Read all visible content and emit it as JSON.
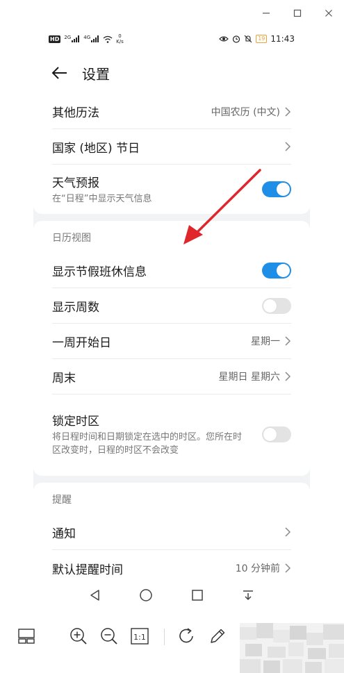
{
  "statusbar": {
    "hd": "HD",
    "sig1_label": "2G",
    "sig2_label": "4G",
    "speed_value": "0",
    "speed_unit": "K/s",
    "battery": "19",
    "time": "11:43"
  },
  "header": {
    "title": "设置"
  },
  "group1": {
    "rows": [
      {
        "label": "其他历法",
        "value": "中国农历 (中文)"
      },
      {
        "label": "国家 (地区) 节日",
        "value": ""
      },
      {
        "label": "天气预报",
        "sub": "在“日程”中显示天气信息",
        "toggle": "on"
      }
    ]
  },
  "group2": {
    "title": "日历视图",
    "rows": [
      {
        "label": "显示节假班休信息",
        "toggle": "on"
      },
      {
        "label": "显示周数",
        "toggle": "off"
      },
      {
        "label": "一周开始日",
        "value": "星期一"
      },
      {
        "label": "周末",
        "value": "星期日 星期六"
      },
      {
        "label": "锁定时区",
        "sub": "将日程时间和日期锁定在选中的时区。您所在时区改变时，日程的时区不会改变",
        "toggle": "off"
      }
    ]
  },
  "group3": {
    "title": "提醒",
    "rows": [
      {
        "label": "通知",
        "value": ""
      },
      {
        "label": "默认提醒时间",
        "value": "10 分钟前"
      }
    ]
  },
  "colors": {
    "accent": "#1f8ee6",
    "annotation_arrow": "#e0262a",
    "toggle_off": "#e3e3e3"
  },
  "icons": {
    "window": [
      "minimize-icon",
      "maximize-icon",
      "close-icon"
    ],
    "toolbar": [
      "layout-icon",
      "zoom-in-icon",
      "zoom-out-icon",
      "actual-size-icon",
      "rotate-icon",
      "edit-icon"
    ],
    "navbar": [
      "back-triangle-icon",
      "home-circle-icon",
      "recents-square-icon",
      "notification-pull-icon"
    ]
  },
  "toolbar": {
    "actual_size_label": "1:1"
  }
}
